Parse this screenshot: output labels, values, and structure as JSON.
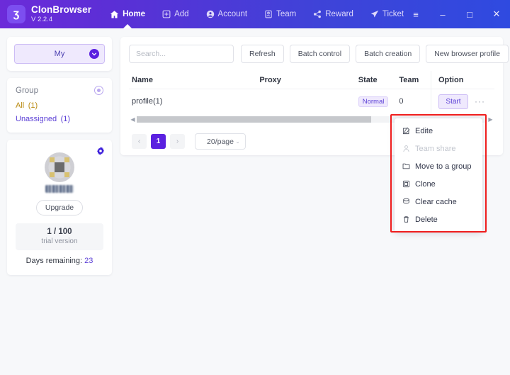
{
  "app": {
    "brand_name": "ClonBrowser",
    "version": "V 2.2.4",
    "logo_glyph": "ʒ"
  },
  "nav": {
    "items": [
      {
        "label": "Home",
        "icon": "home-icon",
        "active": true
      },
      {
        "label": "Add",
        "icon": "plus-square-icon",
        "active": false
      },
      {
        "label": "Account",
        "icon": "user-circle-icon",
        "active": false
      },
      {
        "label": "Team",
        "icon": "id-card-icon",
        "active": false
      },
      {
        "label": "Reward",
        "icon": "share-icon",
        "active": false
      },
      {
        "label": "Ticket",
        "icon": "send-icon",
        "active": false
      }
    ]
  },
  "window_controls": {
    "menu": "≡",
    "minimize": "–",
    "maximize": "□",
    "close": "✕"
  },
  "sidebar": {
    "workspace_selector": {
      "label": "My",
      "icon": "chevron-down-circle-icon"
    },
    "group": {
      "title": "Group",
      "add_icon": "add-group-icon",
      "items": [
        {
          "label": "All (1)",
          "color": "#b98a10"
        },
        {
          "label": "Unassigned (1)",
          "color": "#5b3fd6"
        }
      ]
    },
    "account": {
      "gear_icon": "gear-icon",
      "avatar_icon": "user-avatar",
      "upgrade_label": "Upgrade",
      "trial_count": "1 / 100",
      "trial_label": "trial version",
      "days_label": "Days remaining:",
      "days_value": "23"
    }
  },
  "main": {
    "toolbar": {
      "search_placeholder": "Search...",
      "search_value": "",
      "refresh_label": "Refresh",
      "batch_control_label": "Batch control",
      "batch_creation_label": "Batch creation",
      "new_profile_label": "New browser profile"
    },
    "table": {
      "columns": [
        "Name",
        "Proxy",
        "State",
        "Team",
        "Option"
      ],
      "rows": [
        {
          "name": "profile(1)",
          "proxy": "",
          "state": "Normal",
          "team": "0",
          "start_label": "Start",
          "more_label": "···"
        }
      ]
    },
    "pagination": {
      "prev": "‹",
      "page": "1",
      "next": "›",
      "page_size": "20/page",
      "page_size_caret": "⌄"
    }
  },
  "context_menu": {
    "items": [
      {
        "label": "Edite",
        "icon": "edit-icon",
        "disabled": false
      },
      {
        "label": "Team share",
        "icon": "person-icon",
        "disabled": true
      },
      {
        "label": "Move to a group",
        "icon": "folder-icon",
        "disabled": false
      },
      {
        "label": "Clone",
        "icon": "copy-icon",
        "disabled": false
      },
      {
        "label": "Clear cache",
        "icon": "clear-cache-icon",
        "disabled": false
      },
      {
        "label": "Delete",
        "icon": "trash-icon",
        "disabled": false
      }
    ]
  },
  "colors": {
    "brand_purple": "#5b21e0",
    "header_gradient_start": "#6c2bd9",
    "header_gradient_end": "#2f4ae0",
    "accent_light": "#efe9fd",
    "highlight_red": "#ef1d1d",
    "page_bg": "#f7f8fa"
  }
}
